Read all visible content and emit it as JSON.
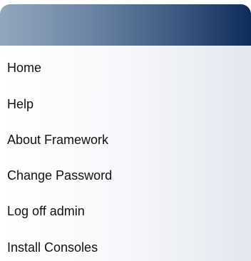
{
  "menu": {
    "items": [
      {
        "label": "Home"
      },
      {
        "label": "Help"
      },
      {
        "label": "About Framework"
      },
      {
        "label": "Change Password"
      },
      {
        "label": "Log off admin"
      },
      {
        "label": "Install Consoles"
      }
    ]
  }
}
